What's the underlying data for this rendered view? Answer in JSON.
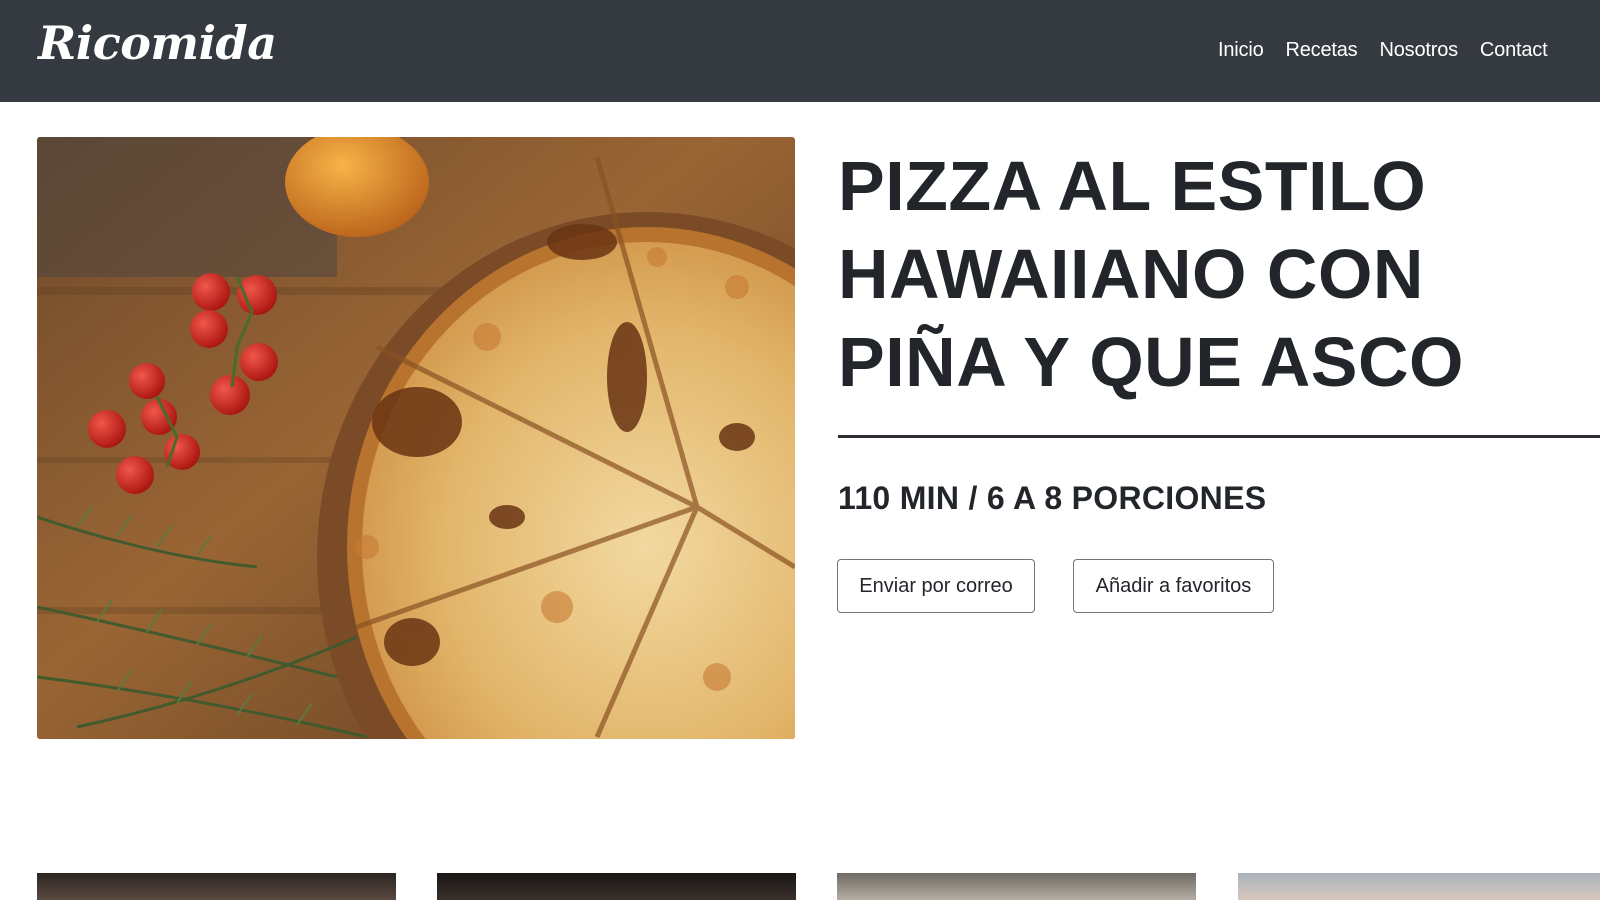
{
  "navbar": {
    "brand": "Ricomida",
    "links": [
      "Inicio",
      "Recetas",
      "Nosotros",
      "Contact"
    ]
  },
  "recipe": {
    "title": "PIZZA AL ESTILO HAWAIIANO CON PIÑA Y QUE ASCO",
    "meta": "110 MIN / 6 A 8 PORCIONES",
    "email_button": "Enviar por correo",
    "favorite_button": "Añadir a favoritos"
  }
}
